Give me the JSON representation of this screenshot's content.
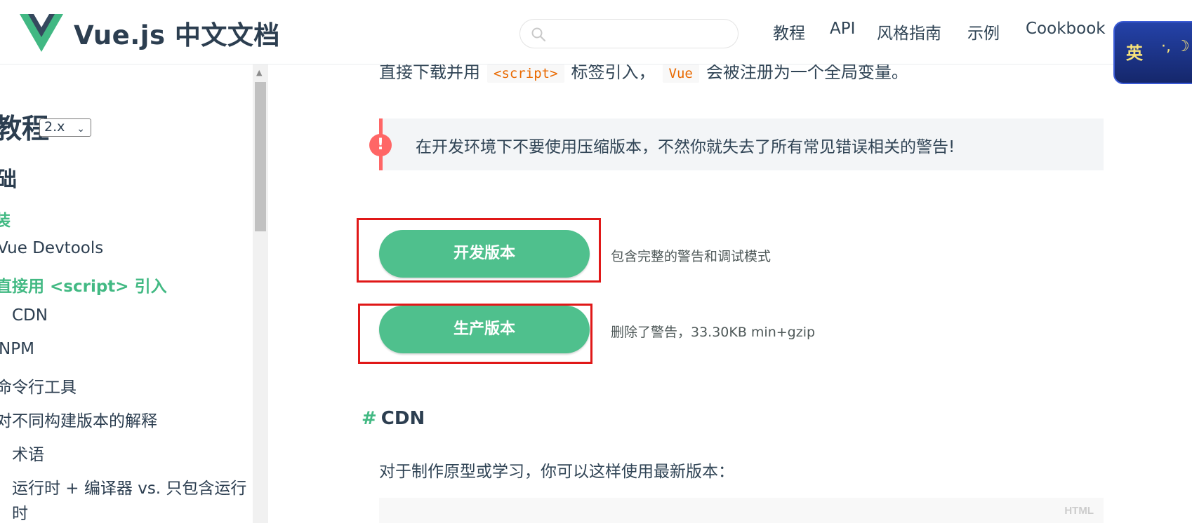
{
  "header": {
    "logo_text": "Vue.js 中文文档",
    "search_placeholder": "",
    "nav": [
      "教程",
      "API",
      "风格指南",
      "示例",
      "Cookbook"
    ],
    "lang_badge": {
      "char": "英",
      "symbol": "·, ☽"
    }
  },
  "sidebar": {
    "title": "教程",
    "version": "2.x",
    "section": "础",
    "items": [
      {
        "label": "装",
        "active": true
      },
      {
        "label": "Vue Devtools",
        "active": false
      },
      {
        "label": "直接用 <script> 引入",
        "active": true
      },
      {
        "label": "CDN",
        "active": false
      },
      {
        "label": "NPM",
        "active": false
      },
      {
        "label": "命令行工具",
        "active": false
      },
      {
        "label": "对不同构建版本的解释",
        "active": false
      },
      {
        "label": "术语",
        "active": false
      },
      {
        "label": "运行时 + 编译器 vs. 只包含运行",
        "active": false
      },
      {
        "label": "时",
        "active": false
      }
    ]
  },
  "content": {
    "intro": {
      "before": "直接下载并用",
      "code1": "<script>",
      "middle": "标签引入，",
      "code2": "Vue",
      "after": "会被注册为一个全局变量。"
    },
    "tip": {
      "text": "在开发环境下不要使用压缩版本，不然你就失去了所有常见错误相关的警告!",
      "icon": "!"
    },
    "downloads": [
      {
        "label": "开发版本",
        "desc": "包含完整的警告和调试模式"
      },
      {
        "label": "生产版本",
        "desc": "删除了警告，33.30KB min+gzip"
      }
    ],
    "cdn_heading": {
      "hash": "#",
      "text": "CDN"
    },
    "cdn_text": "对于制作原型或学习，你可以这样使用最新版本：",
    "code_lang": "HTML"
  },
  "colors": {
    "accent": "#42b983",
    "button": "#4fc08d",
    "warning": "#ff6666",
    "highlight_box": "#e01818"
  }
}
